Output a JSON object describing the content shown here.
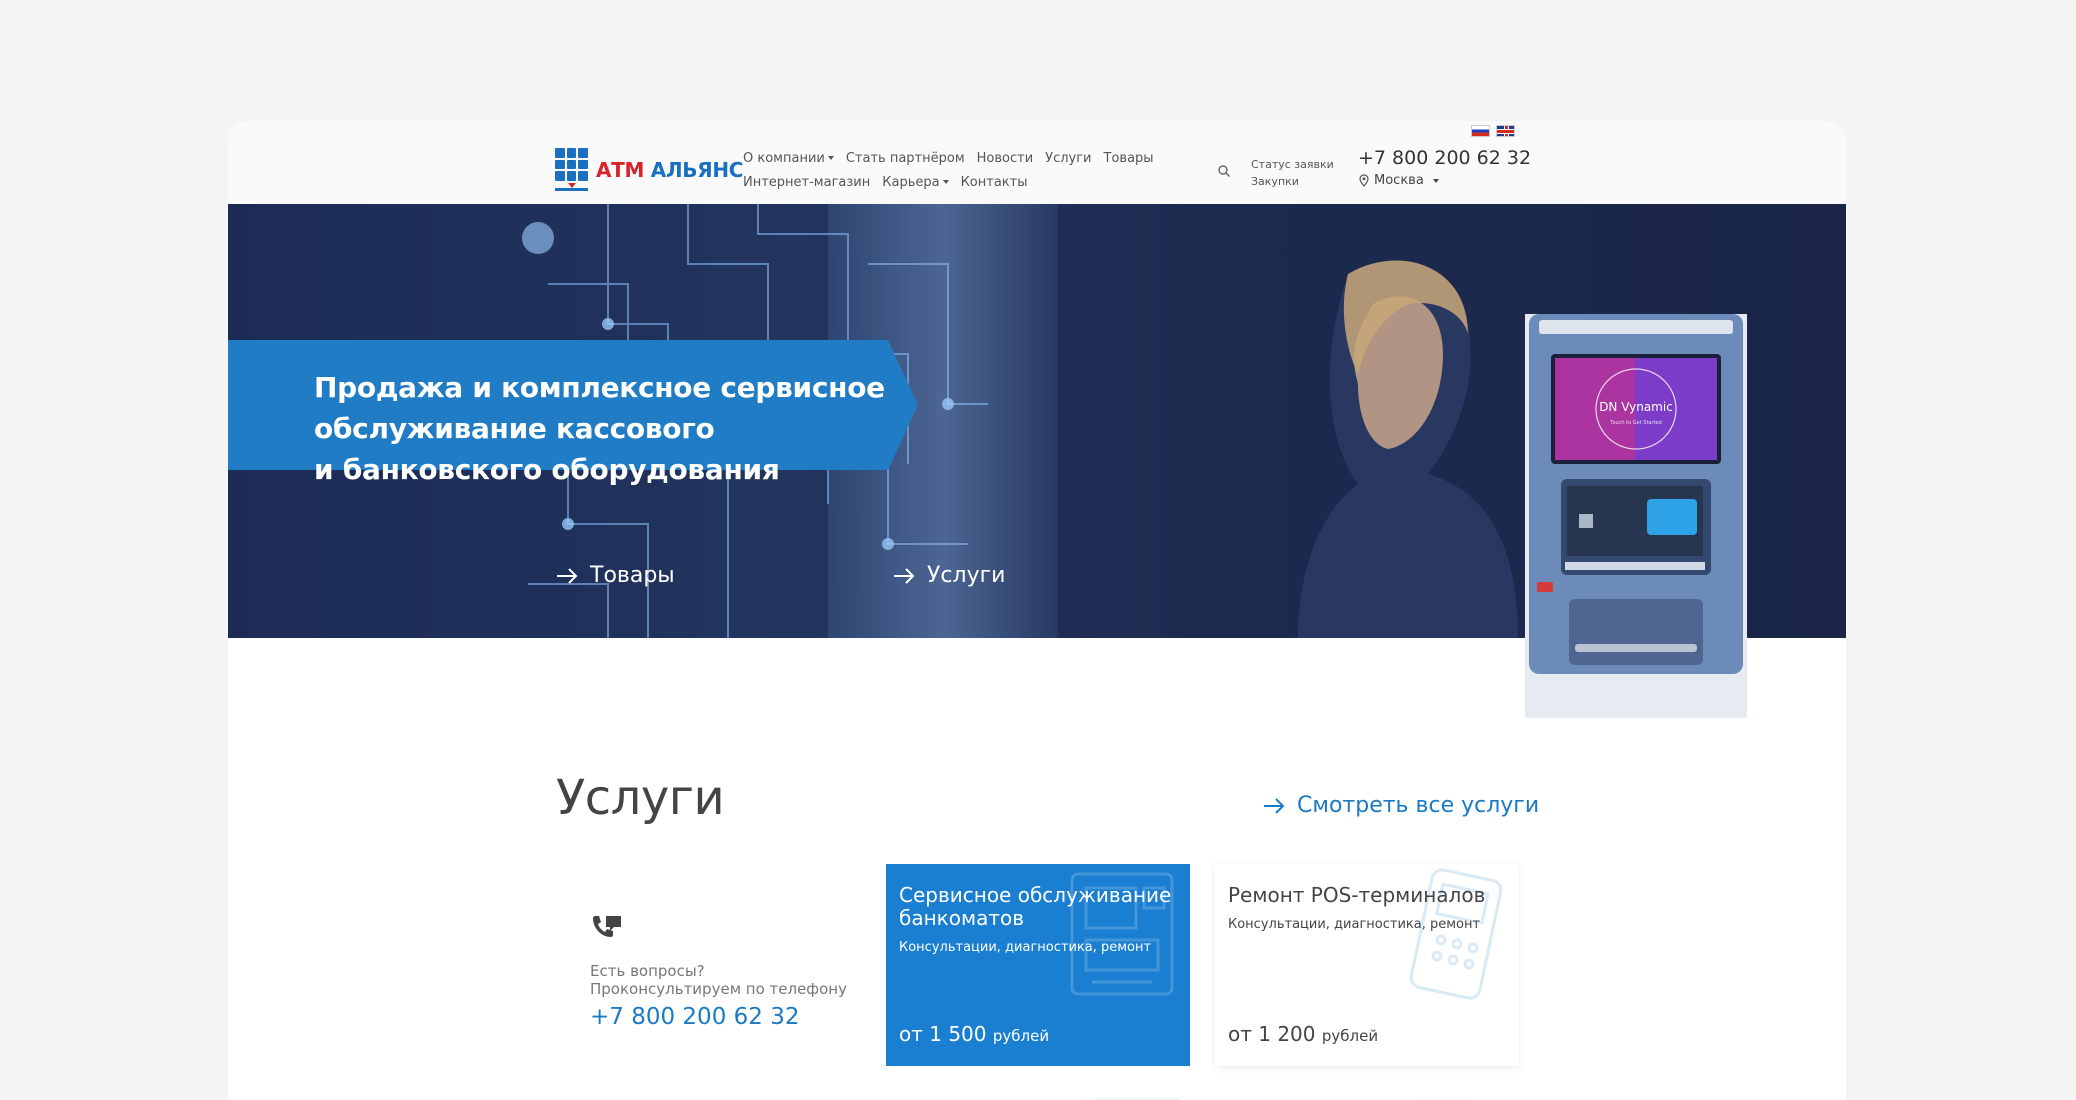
{
  "header": {
    "logo": {
      "part1": "АТМ",
      "part2": "АЛЬЯНС"
    },
    "nav_row1": [
      {
        "label": "О компании",
        "dropdown": true
      },
      {
        "label": "Стать партнёром",
        "dropdown": false
      },
      {
        "label": "Новости",
        "dropdown": false
      },
      {
        "label": "Услуги",
        "dropdown": false
      },
      {
        "label": "Товары",
        "dropdown": false
      }
    ],
    "nav_row2": [
      {
        "label": "Интернет-магазин",
        "dropdown": false
      },
      {
        "label": "Карьера",
        "dropdown": true
      },
      {
        "label": "Контакты",
        "dropdown": false
      }
    ],
    "status_link": "Статус заявки",
    "purchases_link": "Закупки",
    "phone": "+7 800 200 62 32",
    "city": "Москва",
    "languages": [
      "ru",
      "en"
    ]
  },
  "hero": {
    "line1": "Продажа и комплексное сервисное",
    "line2": "обслуживание кассового",
    "line3": "и банковского оборудования",
    "link_goods": "Товары",
    "link_services": "Услуги",
    "atm_screen_title": "DN Vynamic",
    "atm_screen_sub": "Touch to Get Started"
  },
  "services": {
    "title": "Услуги",
    "all_link": "Смотреть все услуги",
    "contact": {
      "question": "Есть вопросы?",
      "consult": "Проконсультируем по телефону",
      "phone": "+7 800 200 62 32"
    },
    "cards": [
      {
        "title": "Сервисное обслуживание банкоматов",
        "subtitle": "Консультации, диагностика, ремонт",
        "price": "от 1 500",
        "currency": "рублей"
      },
      {
        "title": "Ремонт POS-терминалов",
        "subtitle": "Консультации, диагностика, ремонт",
        "price": "от 1 200",
        "currency": "рублей"
      }
    ]
  },
  "colors": {
    "accent_blue": "#1a7fd0",
    "link_blue": "#1a7bc4",
    "logo_red": "#d8232a",
    "hero_dark": "#1b2b55"
  }
}
